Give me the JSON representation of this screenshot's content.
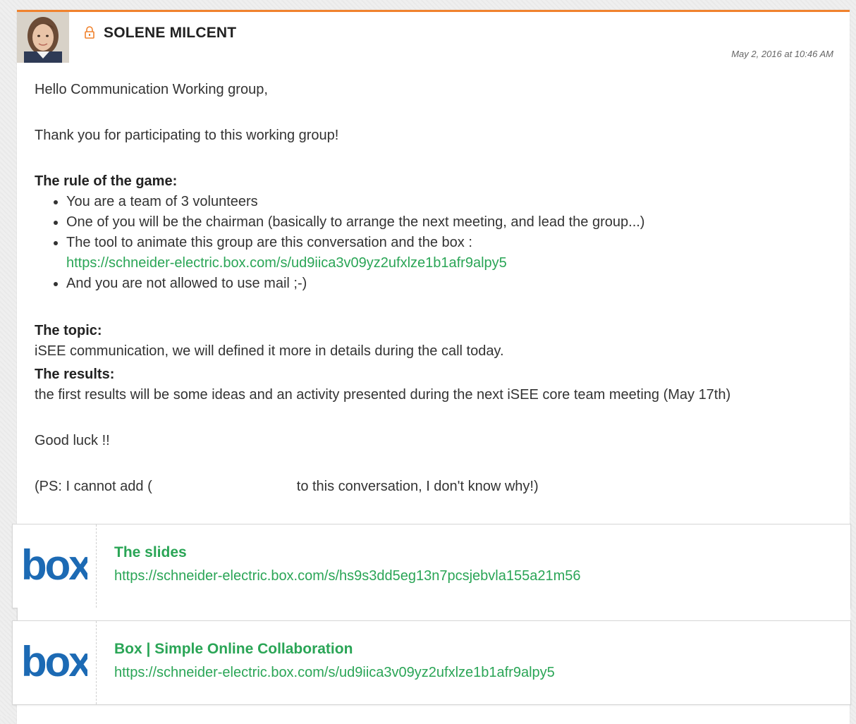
{
  "post": {
    "author": "SOLENE MILCENT",
    "date": "May 2, 2016 at 10:46 AM",
    "greeting": "Hello Communication Working group,",
    "thanks": "Thank you for participating to this working group!",
    "rule_heading": "The rule of the game:",
    "rules": [
      "You are a team of 3 volunteers",
      "One of you will be the chairman (basically to arrange the next meeting, and lead the group...)",
      "The tool to animate this group are this conversation and the box :",
      "And you are not allowed to use mail ;-)"
    ],
    "rule_link": "https://schneider-electric.box.com/s/ud9iica3v09yz2ufxlze1b1afr9alpy5",
    "topic_heading": "The topic:",
    "topic_text": "iSEE communication, we will defined it more in details during the call today.",
    "results_heading": "The results:",
    "results_text": "the first results will be some ideas and an activity presented during the next iSEE core team meeting (May 17th)",
    "good_luck": "Good luck !!",
    "ps_before": "(PS: I cannot add (",
    "ps_after": "to this conversation, I don't know why!)"
  },
  "attachments": [
    {
      "title": "The slides",
      "url": "https://schneider-electric.box.com/s/hs9s3dd5eg13n7pcsjebvla155a21m56",
      "logo": "box-logo"
    },
    {
      "title": "Box | Simple Online Collaboration",
      "url": "https://schneider-electric.box.com/s/ud9iica3v09yz2ufxlze1b1afr9alpy5",
      "logo": "box-logo"
    }
  ],
  "colors": {
    "accent": "#f0822d",
    "link": "#2aa556",
    "box_blue": "#1c6ab4"
  }
}
